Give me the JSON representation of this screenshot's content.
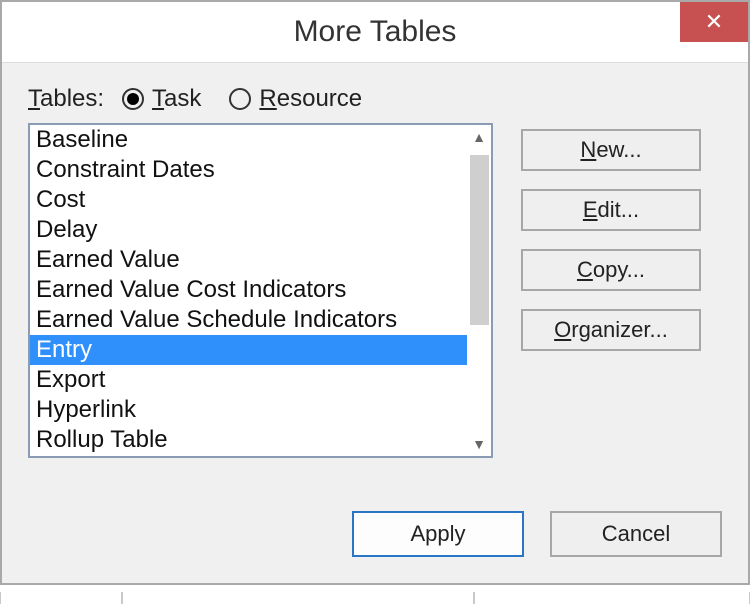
{
  "window": {
    "title": "More Tables",
    "close_glyph": "✕"
  },
  "filter": {
    "label": "Tables:",
    "option_task": "Task",
    "option_resource": "Resource",
    "selected": "task"
  },
  "list": {
    "items": [
      "Baseline",
      "Constraint Dates",
      "Cost",
      "Delay",
      "Earned Value",
      "Earned Value Cost Indicators",
      "Earned Value Schedule Indicators",
      "Entry",
      "Export",
      "Hyperlink",
      "Rollup Table"
    ],
    "selected_index": 7
  },
  "buttons": {
    "new": "New...",
    "edit": "Edit...",
    "copy": "Copy...",
    "organizer": "Organizer...",
    "apply": "Apply",
    "cancel": "Cancel"
  },
  "scroll": {
    "up_glyph": "▲",
    "down_glyph": "▼"
  }
}
